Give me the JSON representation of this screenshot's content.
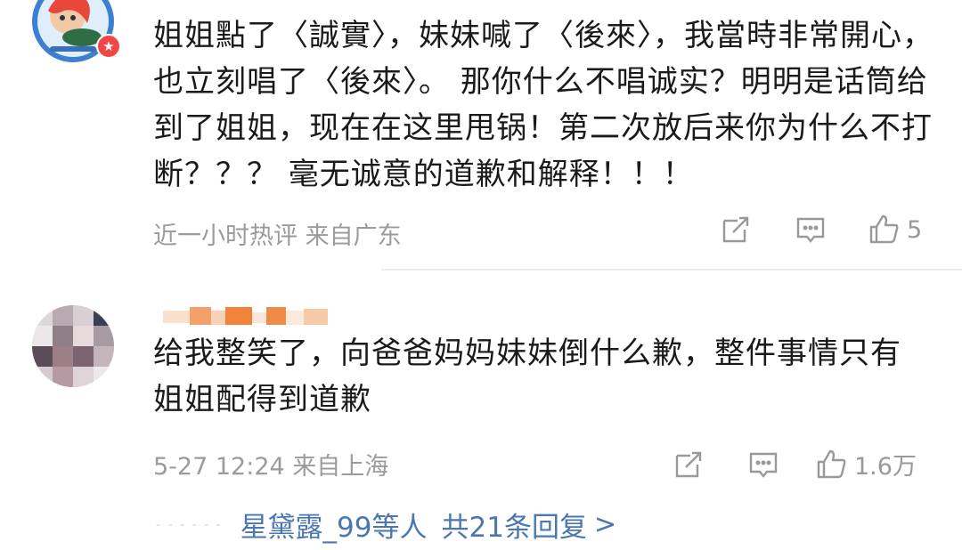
{
  "comments": [
    {
      "text": "姐姐點了〈誠實〉，妹妹喊了〈後來〉，我當時非常開心，也立刻唱了〈後來〉。 那你什么不唱诚实？明明是话筒给到了姐姐，现在在这里甩锅！第二次放后来你为什么不打断？？？ 毫无诚意的道歉和解释！！！",
      "time": "近一小时热评",
      "location": "来自广东",
      "likes": "5"
    },
    {
      "text": "给我整笑了，向爸爸妈妈妹妹倒什么歉，整件事情只有姐姐配得到道歉",
      "time": "5-27 12:24",
      "location": "来自上海",
      "likes": "1.6万"
    }
  ],
  "replies": {
    "users": "星黛露_99",
    "suffix": "等人",
    "total": "共21条回复",
    "arrow": ">",
    "dash": "- - - - - -"
  },
  "colors": {
    "link": "#4a77b2",
    "meta": "#9b9b9b",
    "badge": "#f04646"
  },
  "icons": [
    "repost-icon",
    "comment-icon",
    "like-icon",
    "vip-badge-icon"
  ]
}
